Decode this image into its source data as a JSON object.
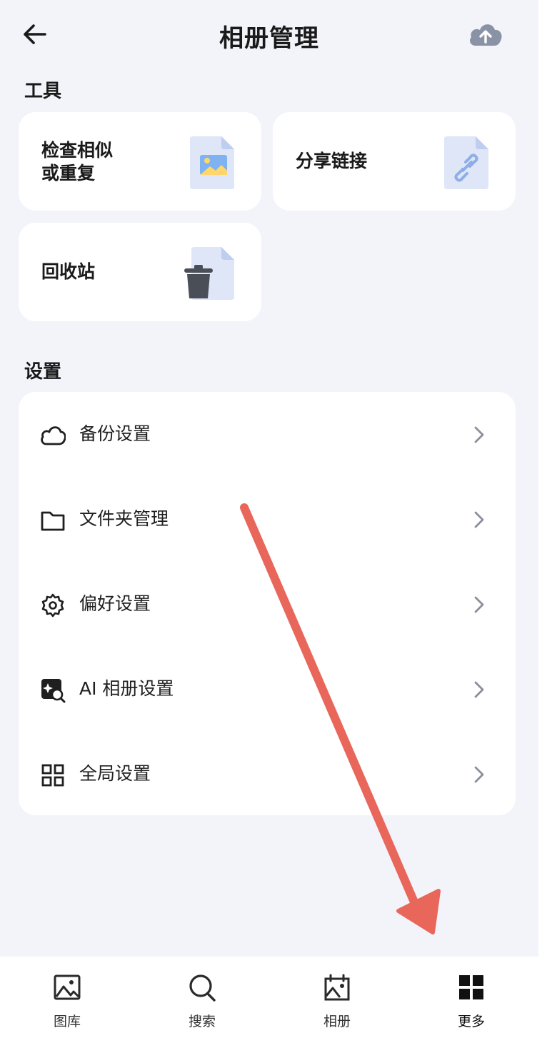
{
  "header": {
    "title": "相册管理",
    "back_icon": "arrow-left-icon",
    "upload_icon": "cloud-upload-icon"
  },
  "tools": {
    "section_title": "工具",
    "items": [
      {
        "label_line1": "检查相似",
        "label_line2": "或重复",
        "icon": "image-file-icon"
      },
      {
        "label": "分享链接",
        "icon": "link-file-icon"
      },
      {
        "label": "回收站",
        "icon": "trash-file-icon"
      }
    ]
  },
  "settings": {
    "section_title": "设置",
    "items": [
      {
        "label": "备份设置",
        "icon": "cloud-icon"
      },
      {
        "label": "文件夹管理",
        "icon": "folder-icon"
      },
      {
        "label": "偏好设置",
        "icon": "gear-icon"
      },
      {
        "label": "AI 相册设置",
        "icon": "ai-search-icon"
      },
      {
        "label": "全局设置",
        "icon": "grid-icon"
      }
    ]
  },
  "bottom_nav": {
    "items": [
      {
        "label": "图库",
        "icon": "image-icon"
      },
      {
        "label": "搜索",
        "icon": "search-icon"
      },
      {
        "label": "相册",
        "icon": "album-icon"
      },
      {
        "label": "更多",
        "icon": "grid-icon",
        "active": true
      }
    ]
  },
  "colors": {
    "background": "#f3f4f9",
    "card": "#ffffff",
    "annotation_arrow": "#e8665a",
    "upload_icon": "#8a93a6"
  }
}
